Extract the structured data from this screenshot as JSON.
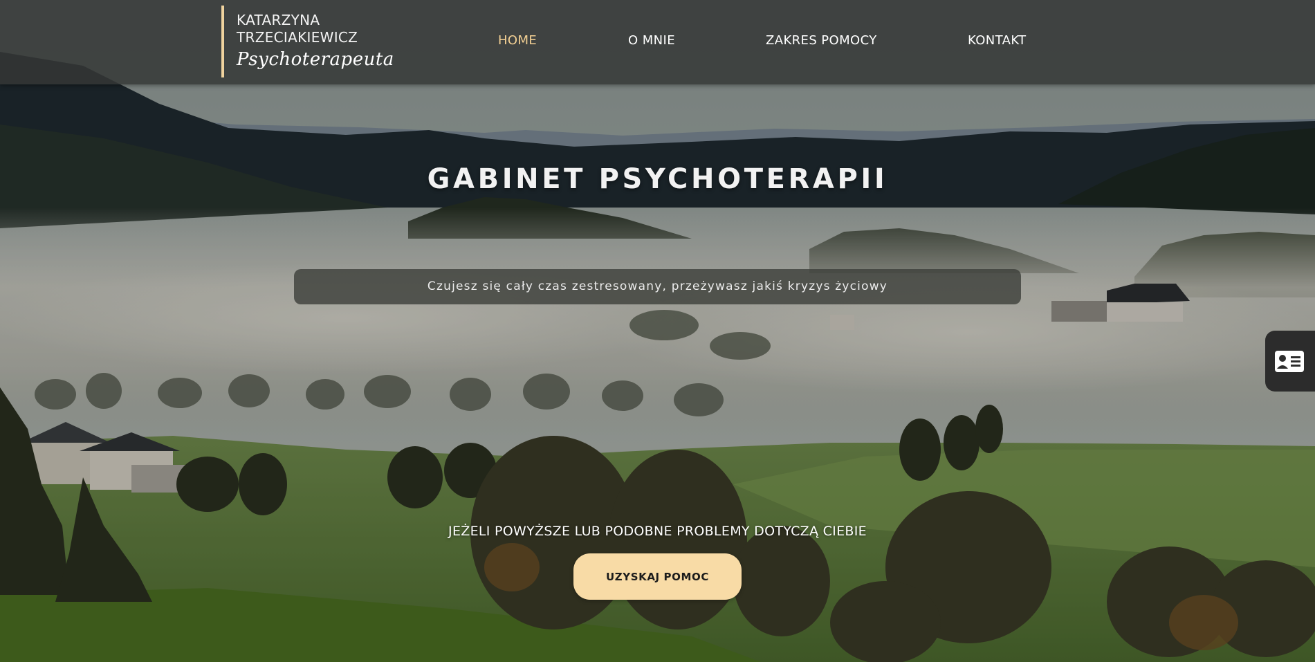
{
  "brand": {
    "line1": "KATARZYNA",
    "line2": "TRZECIAKIEWICZ",
    "subtitle": "Psychoterapeuta",
    "accent_color": "#f0d39e"
  },
  "nav": {
    "items": [
      {
        "label": "HOME",
        "active": true
      },
      {
        "label": "O MNIE",
        "active": false
      },
      {
        "label": "ZAKRES POMOCY",
        "active": false
      },
      {
        "label": "KONTAKT",
        "active": false
      }
    ],
    "active_color": "#f2cf93"
  },
  "hero": {
    "title": "GABINET PSYCHOTERAPII",
    "subtitle": "Czujesz się cały czas zestresowany, przeżywasz jakiś kryzys życiowy",
    "cta_caption": "JEŻELI POWYŻSZE LUB PODOBNE PROBLEMY DOTYCZĄ CIEBIE",
    "cta_button": "UZYSKAJ POMOC",
    "cta_color": "#f8dba6"
  },
  "side_tab": {
    "icon": "contact-card-icon"
  }
}
